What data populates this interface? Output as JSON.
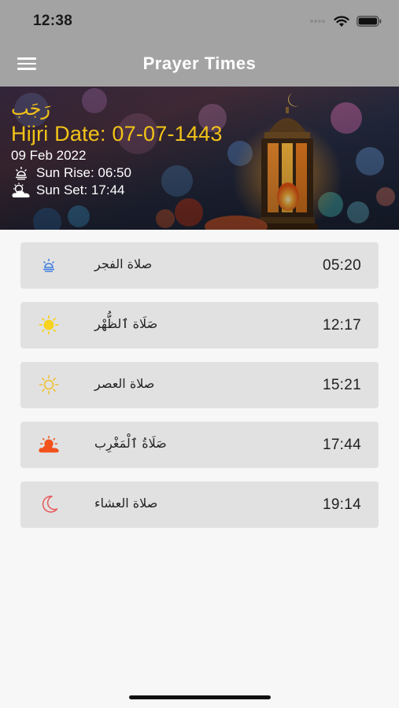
{
  "status_bar": {
    "time": "12:38"
  },
  "nav": {
    "title": "Prayer Times",
    "menu_icon": "hamburger-menu-icon"
  },
  "header": {
    "hijri_month": "رَجَب",
    "hijri_date": "Hijri Date: 07-07-1443",
    "gregorian_date": "09 Feb 2022",
    "sunrise": "Sun Rise: 06:50",
    "sunset": "Sun Set: 17:44"
  },
  "prayers": [
    {
      "name": "صلاة الفجر",
      "time": "05:20",
      "icon": "sunrise-icon",
      "icon_color": "#3f7de0"
    },
    {
      "name": "صَلَاة ٱلظُّهْر",
      "time": "12:17",
      "icon": "sun-icon",
      "icon_color": "#f7d21e"
    },
    {
      "name": "صلاة العصر",
      "time": "15:21",
      "icon": "sun-outline-icon",
      "icon_color": "#f0c030"
    },
    {
      "name": "صَلَاةُ ٱلْمَغْرِب",
      "time": "17:44",
      "icon": "sunset-cloud-icon",
      "icon_color": "#f2521c"
    },
    {
      "name": "صلاة العشاء",
      "time": "19:14",
      "icon": "moon-icon",
      "icon_color": "#e8585a"
    }
  ]
}
